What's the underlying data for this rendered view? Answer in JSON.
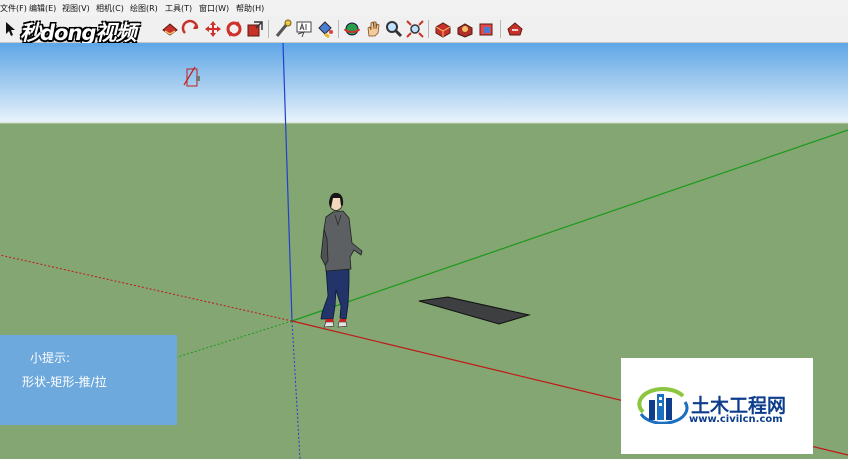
{
  "menu": [
    {
      "label": "文件(F)"
    },
    {
      "label": "编辑(E)"
    },
    {
      "label": "视图(V)"
    },
    {
      "label": "相机(C)"
    },
    {
      "label": "绘图(R)"
    },
    {
      "label": "工具(T)"
    },
    {
      "label": "窗口(W)"
    },
    {
      "label": "帮助(H)"
    }
  ],
  "overlay": {
    "logo_text": "秒dong视频"
  },
  "tip": {
    "title": "小提示:",
    "text": "形状-矩形-推/拉"
  },
  "watermark": {
    "name": "土木工程网",
    "url": "www.civilcn.com"
  },
  "colors": {
    "sky_top": "#5ea6e6",
    "sky_bottom": "#e9f3fb",
    "ground": "#84a672",
    "axis_blue": "#2040d0",
    "axis_green": "#1a9a1a",
    "axis_red": "#c01818",
    "tip_bg": "#6ea9dd",
    "brand_blue": "#0d3d8c"
  },
  "tools": [
    {
      "name": "select-tool-icon"
    },
    {
      "name": "paint-bucket-icon"
    },
    {
      "name": "orbit-icon"
    },
    {
      "name": "move-icon"
    },
    {
      "name": "rotate-icon"
    },
    {
      "name": "scale-icon"
    },
    {
      "name": "tape-measure-icon"
    },
    {
      "name": "text-icon"
    },
    {
      "name": "paint-bucket-tool-icon"
    },
    {
      "name": "orbit-tool-icon"
    },
    {
      "name": "pan-icon"
    },
    {
      "name": "zoom-icon"
    },
    {
      "name": "zoom-extents-icon"
    },
    {
      "name": "get-models-icon"
    },
    {
      "name": "share-model-icon"
    },
    {
      "name": "share-component-icon"
    },
    {
      "name": "extension-warehouse-icon"
    }
  ]
}
